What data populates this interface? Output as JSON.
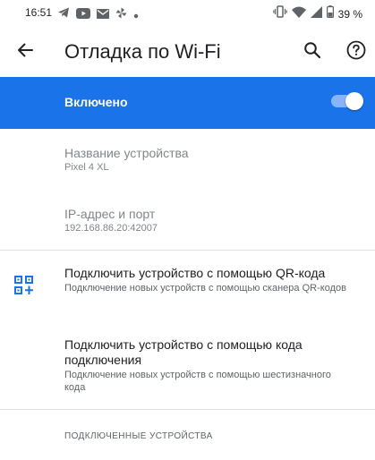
{
  "status_bar": {
    "time": "16:51",
    "left_icons": [
      "telegram-icon",
      "youtube-icon",
      "mail-icon",
      "pinwheel-icon",
      "dot-icon"
    ],
    "right_icons": [
      "vibrate-icon",
      "wifi-icon",
      "signal-icon",
      "battery-icon"
    ],
    "battery": "39 %"
  },
  "app_bar": {
    "title": "Отладка по Wi-Fi",
    "icons": [
      "back-arrow-icon",
      "search-icon",
      "help-icon"
    ]
  },
  "master_switch": {
    "label": "Включено",
    "enabled": true,
    "colors": {
      "background": "#1a73e8",
      "track": "#8ab4f8",
      "thumb": "#ffffff"
    }
  },
  "device_name": {
    "title": "Название устройства",
    "value": "Pixel 4 XL"
  },
  "ip_port": {
    "title": "IP-адрес и порт",
    "value": "192.168.86.20:42007"
  },
  "pair_qr": {
    "title": "Подключить устройство с помощью QR-кода",
    "summary": "Подключение новых устройств с помощью сканера QR-кодов",
    "icon": "qr-code-add-icon",
    "icon_color": "#1a73e8"
  },
  "pair_code": {
    "title": "Подключить устройство с помощью кода подключения",
    "summary": "Подключение новых устройств с помощью шестизначного кода"
  },
  "paired_devices": {
    "header": "ПОДКЛЮЧЕННЫЕ УСТРОЙСТВА"
  }
}
